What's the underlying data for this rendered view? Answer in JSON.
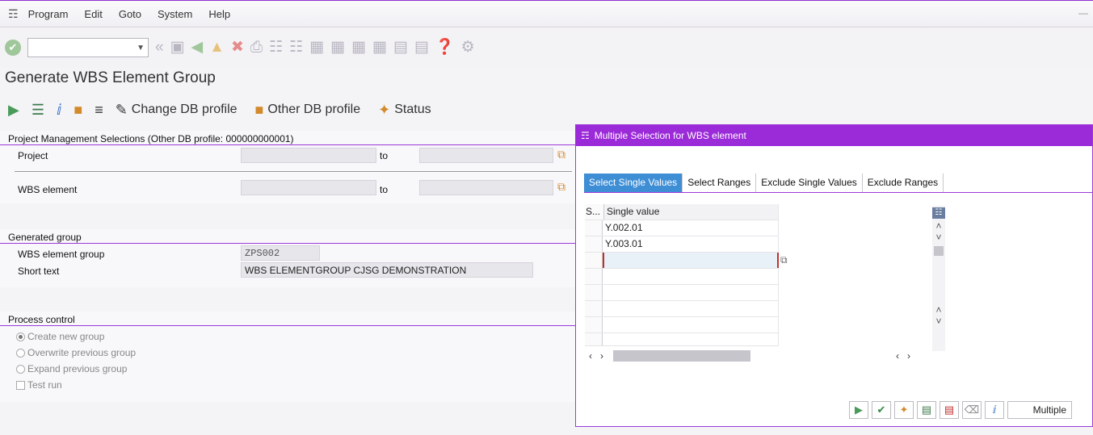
{
  "menu": {
    "items": [
      "Program",
      "Edit",
      "Goto",
      "System",
      "Help"
    ]
  },
  "toolbar": {
    "command_placeholder": ""
  },
  "page": {
    "title": "Generate WBS Element Group"
  },
  "app_toolbar": {
    "change_db_profile": "Change DB profile",
    "other_db_profile": "Other DB profile",
    "status": "Status"
  },
  "pm_section": {
    "header": "Project Management Selections (Other DB profile: 000000000001)",
    "project_label": "Project",
    "wbs_label": "WBS element",
    "to_label": "to"
  },
  "generated_group": {
    "header": "Generated group",
    "wbs_group_label": "WBS element group",
    "wbs_group_value": "ZPS002",
    "short_text_label": "Short text",
    "short_text_value": "WBS ELEMENTGROUP CJSG DEMONSTRATION"
  },
  "process_control": {
    "header": "Process control",
    "options": [
      "Create new group",
      "Overwrite previous group",
      "Expand previous group"
    ],
    "selected": "Create new group",
    "test_run": "Test run"
  },
  "dialog": {
    "title": "Multiple Selection for WBS element",
    "tabs": [
      "Select Single Values",
      "Select Ranges",
      "Exclude Single Values",
      "Exclude Ranges"
    ],
    "active_tab": "Select Single Values",
    "col_sel": "S...",
    "col_value": "Single value",
    "rows": [
      "Y.002.01",
      "Y.003.01",
      "",
      "",
      "",
      "",
      "",
      ""
    ],
    "multiple_label": "Multiple"
  }
}
